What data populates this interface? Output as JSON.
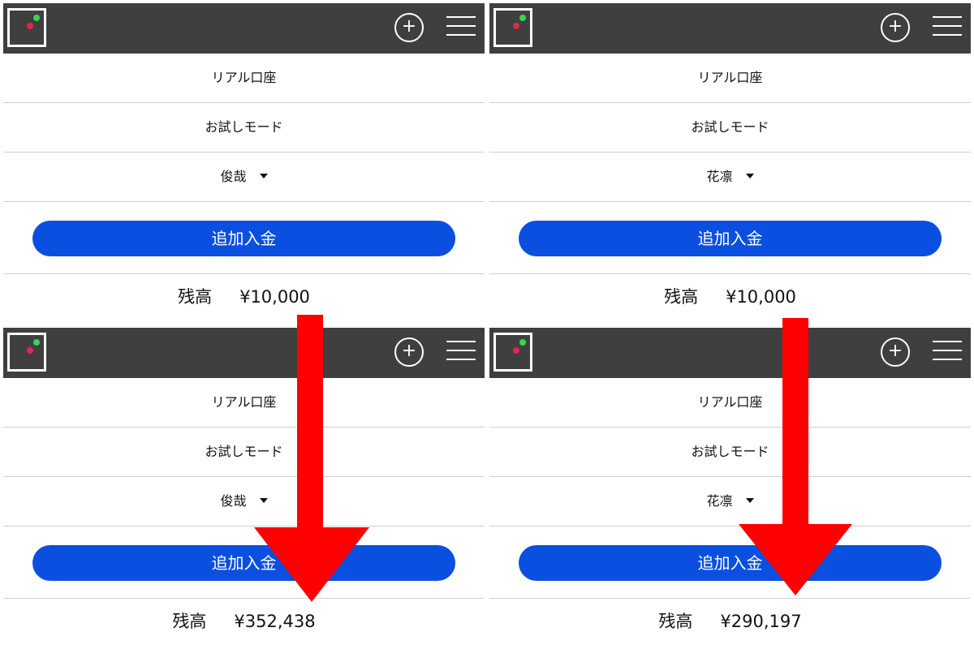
{
  "panels": [
    {
      "tab_real": "リアル口座",
      "tab_trial": "お試しモード",
      "user_name": "俊哉",
      "deposit_label": "追加入金",
      "balance_label": "残高",
      "balance_value": "¥10,000"
    },
    {
      "tab_real": "リアル口座",
      "tab_trial": "お試しモード",
      "user_name": "花凛",
      "deposit_label": "追加入金",
      "balance_label": "残高",
      "balance_value": "¥10,000"
    },
    {
      "tab_real": "リアル口座",
      "tab_trial": "お試しモード",
      "user_name": "俊哉",
      "deposit_label": "追加入金",
      "balance_label": "残高",
      "balance_value": "¥352,438"
    },
    {
      "tab_real": "リアル口座",
      "tab_trial": "お試しモード",
      "user_name": "花凛",
      "deposit_label": "追加入金",
      "balance_label": "残高",
      "balance_value": "¥290,197"
    }
  ],
  "header": {
    "add_icon": "+",
    "menu_icon": "hamburger-menu-icon",
    "logo_icon": "app-logo"
  },
  "colors": {
    "header_bg": "#3f3f3f",
    "button_bg": "#0b4fe0",
    "arrow": "#ff0000",
    "logo_green": "#39d353",
    "logo_red": "#e0284c"
  }
}
